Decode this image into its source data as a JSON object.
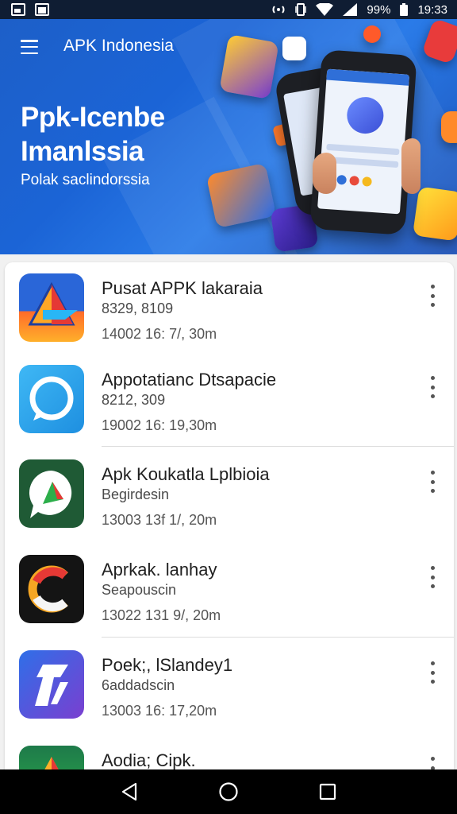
{
  "status_bar": {
    "battery": "99%",
    "time": "19:33"
  },
  "header": {
    "app_name": "APK Indonesia",
    "hero_title_line1": "Ppk-Icenbe",
    "hero_title_line2": "Imanlssia",
    "hero_subtitle": "Polak saclindorssia"
  },
  "apps": [
    {
      "title": "Pusat APPK lakaraia",
      "subtitle": "8329, 8109",
      "meta": "14002 16: 7/, 30m",
      "icon": "triangle-arrow-icon"
    },
    {
      "title": "Appotatianc Dtsapacie",
      "subtitle": "8212, 309",
      "meta": "19002 16: 19,30m",
      "icon": "chat-bubble-icon"
    },
    {
      "title": "Apk Koukatla Lplbioia",
      "subtitle": "Begirdesin",
      "meta": "13003 13f 1/, 20m",
      "icon": "chat-triangle-icon"
    },
    {
      "title": "Aprkak. lanhay",
      "subtitle": "Seapouscin",
      "meta": "13022 131 9/, 20m",
      "icon": "c-letter-icon"
    },
    {
      "title": "Poek;, lSlandey1",
      "subtitle": "6addadscin",
      "meta": "13003 16: 17,20m",
      "icon": "slash-logo-icon"
    },
    {
      "title": "Aodia; Cipk.",
      "subtitle": "",
      "meta": "",
      "icon": "triangle-icon"
    }
  ],
  "colors": {
    "hero": "#1b64d6",
    "status_bar": "#0f1d33",
    "nav_bar": "#000000"
  }
}
